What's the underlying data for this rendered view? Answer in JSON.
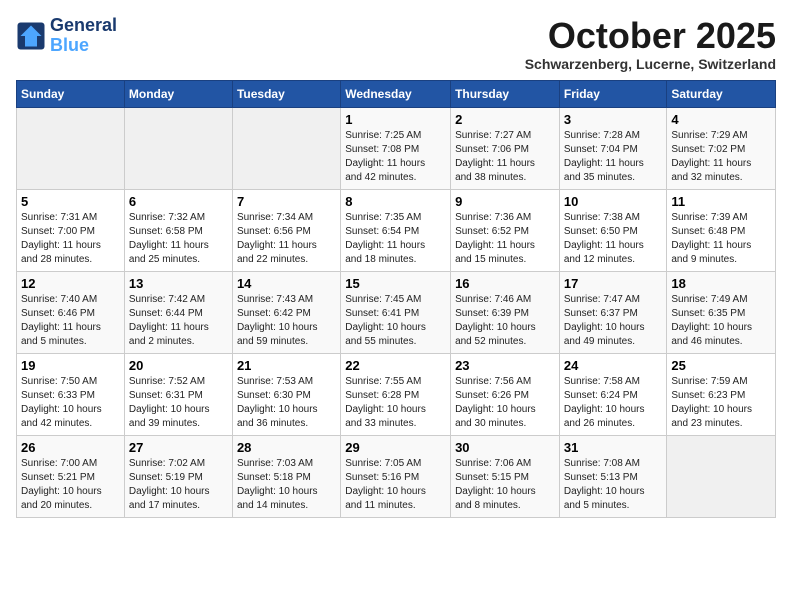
{
  "header": {
    "logo_line1": "General",
    "logo_line2": "Blue",
    "month": "October 2025",
    "location": "Schwarzenberg, Lucerne, Switzerland"
  },
  "weekdays": [
    "Sunday",
    "Monday",
    "Tuesday",
    "Wednesday",
    "Thursday",
    "Friday",
    "Saturday"
  ],
  "weeks": [
    [
      {
        "day": "",
        "info": ""
      },
      {
        "day": "",
        "info": ""
      },
      {
        "day": "",
        "info": ""
      },
      {
        "day": "1",
        "info": "Sunrise: 7:25 AM\nSunset: 7:08 PM\nDaylight: 11 hours\nand 42 minutes."
      },
      {
        "day": "2",
        "info": "Sunrise: 7:27 AM\nSunset: 7:06 PM\nDaylight: 11 hours\nand 38 minutes."
      },
      {
        "day": "3",
        "info": "Sunrise: 7:28 AM\nSunset: 7:04 PM\nDaylight: 11 hours\nand 35 minutes."
      },
      {
        "day": "4",
        "info": "Sunrise: 7:29 AM\nSunset: 7:02 PM\nDaylight: 11 hours\nand 32 minutes."
      }
    ],
    [
      {
        "day": "5",
        "info": "Sunrise: 7:31 AM\nSunset: 7:00 PM\nDaylight: 11 hours\nand 28 minutes."
      },
      {
        "day": "6",
        "info": "Sunrise: 7:32 AM\nSunset: 6:58 PM\nDaylight: 11 hours\nand 25 minutes."
      },
      {
        "day": "7",
        "info": "Sunrise: 7:34 AM\nSunset: 6:56 PM\nDaylight: 11 hours\nand 22 minutes."
      },
      {
        "day": "8",
        "info": "Sunrise: 7:35 AM\nSunset: 6:54 PM\nDaylight: 11 hours\nand 18 minutes."
      },
      {
        "day": "9",
        "info": "Sunrise: 7:36 AM\nSunset: 6:52 PM\nDaylight: 11 hours\nand 15 minutes."
      },
      {
        "day": "10",
        "info": "Sunrise: 7:38 AM\nSunset: 6:50 PM\nDaylight: 11 hours\nand 12 minutes."
      },
      {
        "day": "11",
        "info": "Sunrise: 7:39 AM\nSunset: 6:48 PM\nDaylight: 11 hours\nand 9 minutes."
      }
    ],
    [
      {
        "day": "12",
        "info": "Sunrise: 7:40 AM\nSunset: 6:46 PM\nDaylight: 11 hours\nand 5 minutes."
      },
      {
        "day": "13",
        "info": "Sunrise: 7:42 AM\nSunset: 6:44 PM\nDaylight: 11 hours\nand 2 minutes."
      },
      {
        "day": "14",
        "info": "Sunrise: 7:43 AM\nSunset: 6:42 PM\nDaylight: 10 hours\nand 59 minutes."
      },
      {
        "day": "15",
        "info": "Sunrise: 7:45 AM\nSunset: 6:41 PM\nDaylight: 10 hours\nand 55 minutes."
      },
      {
        "day": "16",
        "info": "Sunrise: 7:46 AM\nSunset: 6:39 PM\nDaylight: 10 hours\nand 52 minutes."
      },
      {
        "day": "17",
        "info": "Sunrise: 7:47 AM\nSunset: 6:37 PM\nDaylight: 10 hours\nand 49 minutes."
      },
      {
        "day": "18",
        "info": "Sunrise: 7:49 AM\nSunset: 6:35 PM\nDaylight: 10 hours\nand 46 minutes."
      }
    ],
    [
      {
        "day": "19",
        "info": "Sunrise: 7:50 AM\nSunset: 6:33 PM\nDaylight: 10 hours\nand 42 minutes."
      },
      {
        "day": "20",
        "info": "Sunrise: 7:52 AM\nSunset: 6:31 PM\nDaylight: 10 hours\nand 39 minutes."
      },
      {
        "day": "21",
        "info": "Sunrise: 7:53 AM\nSunset: 6:30 PM\nDaylight: 10 hours\nand 36 minutes."
      },
      {
        "day": "22",
        "info": "Sunrise: 7:55 AM\nSunset: 6:28 PM\nDaylight: 10 hours\nand 33 minutes."
      },
      {
        "day": "23",
        "info": "Sunrise: 7:56 AM\nSunset: 6:26 PM\nDaylight: 10 hours\nand 30 minutes."
      },
      {
        "day": "24",
        "info": "Sunrise: 7:58 AM\nSunset: 6:24 PM\nDaylight: 10 hours\nand 26 minutes."
      },
      {
        "day": "25",
        "info": "Sunrise: 7:59 AM\nSunset: 6:23 PM\nDaylight: 10 hours\nand 23 minutes."
      }
    ],
    [
      {
        "day": "26",
        "info": "Sunrise: 7:00 AM\nSunset: 5:21 PM\nDaylight: 10 hours\nand 20 minutes."
      },
      {
        "day": "27",
        "info": "Sunrise: 7:02 AM\nSunset: 5:19 PM\nDaylight: 10 hours\nand 17 minutes."
      },
      {
        "day": "28",
        "info": "Sunrise: 7:03 AM\nSunset: 5:18 PM\nDaylight: 10 hours\nand 14 minutes."
      },
      {
        "day": "29",
        "info": "Sunrise: 7:05 AM\nSunset: 5:16 PM\nDaylight: 10 hours\nand 11 minutes."
      },
      {
        "day": "30",
        "info": "Sunrise: 7:06 AM\nSunset: 5:15 PM\nDaylight: 10 hours\nand 8 minutes."
      },
      {
        "day": "31",
        "info": "Sunrise: 7:08 AM\nSunset: 5:13 PM\nDaylight: 10 hours\nand 5 minutes."
      },
      {
        "day": "",
        "info": ""
      }
    ]
  ]
}
